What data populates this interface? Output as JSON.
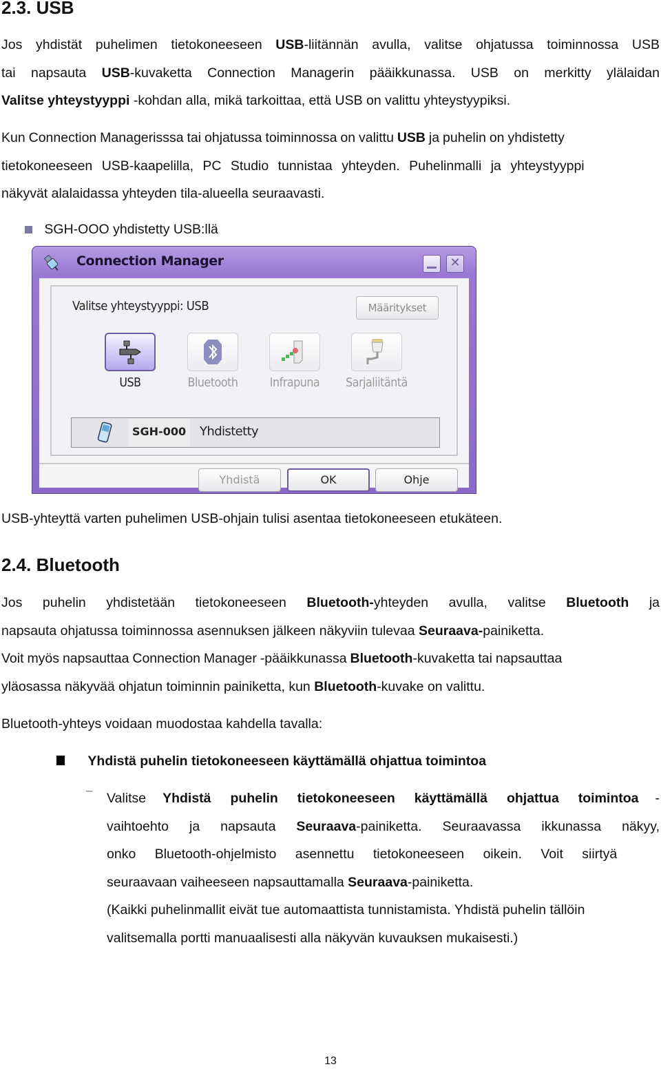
{
  "section_usb": {
    "heading": "2.3. USB",
    "p1": {
      "l1": [
        "Jos yhdistät puhelimen tietokoneeseen ",
        "USB",
        "-liitännän avulla, valitse ohjatussa toiminnossa USB"
      ],
      "l2": [
        "tai napsauta ",
        "USB",
        "-kuvaketta Connection Managerin pääikkunassa. USB on merkitty ylälaidan"
      ],
      "l3": [
        "Valitse yhteystyyppi",
        " -kohdan alla, mikä tarkoittaa, että USB on valittu yhteystyypiksi."
      ]
    },
    "p2": {
      "l1": [
        "Kun Connection Managerisssa tai ohjatussa toiminnossa on valittu ",
        "USB",
        " ja puhelin on yhdistetty"
      ],
      "l2": "tietokoneeseen USB-kaapelilla, PC Studio tunnistaa yhteyden. Puhelinmalli ja yhteystyyppi",
      "l3": "näkyvät alalaidassa yhteyden tila-alueella seuraavasti."
    },
    "bullet": "SGH-OOO yhdistetty USB:llä",
    "after_window": "USB-yhteyttä varten puhelimen USB-ohjain tulisi asentaa tietokoneeseen etukäteen."
  },
  "window": {
    "title": "Connection Manager",
    "app_icon": "usb-plug-icon",
    "minimize_icon": "minimize-icon",
    "close_icon": "close-icon",
    "connection_type_label": "Valitse yhteystyyppi: USB",
    "settings_button": "Määritykset",
    "connection_types": [
      {
        "label": "USB",
        "icon": "usb-icon",
        "selected": true
      },
      {
        "label": "Bluetooth",
        "icon": "bluetooth-icon",
        "selected": false
      },
      {
        "label": "Infrapuna",
        "icon": "infrared-icon",
        "selected": false
      },
      {
        "label": "Sarjaliitäntä",
        "icon": "serial-cable-icon",
        "selected": false
      }
    ],
    "status": {
      "phone_icon": "phone-icon",
      "model": "SGH-000",
      "state": "Yhdistetty"
    },
    "buttons": {
      "connect": "Yhdistä",
      "ok": "OK",
      "help": "Ohje"
    },
    "accent_color": "#9878d2"
  },
  "section_bt": {
    "heading": "2.4. Bluetooth",
    "p1": {
      "l1": [
        "Jos puhelin yhdistetään tietokoneeseen ",
        "Bluetooth-",
        "yhteyden avulla, valitse ",
        "Bluetooth",
        " ja"
      ],
      "l2": [
        "napsauta ohjatussa toiminnossa asennuksen jälkeen näkyviin tulevaa ",
        "Seuraava-",
        "painiketta."
      ],
      "l3": [
        "Voit myös napsauttaa Connection Manager -pääikkunassa ",
        "Bluetooth",
        "-kuvaketta tai napsauttaa"
      ],
      "l4": [
        "yläosassa näkyvää ohjatun toiminnin painiketta, kun ",
        "Bluetooth",
        "-kuvake on valittu."
      ]
    },
    "intro": "Bluetooth-yhteys voidaan muodostaa kahdella tavalla:",
    "bullet_heading": "Yhdistä puhelin tietokoneeseen käyttämällä ohjattua toimintoa",
    "dash": "−",
    "sub": {
      "l1": [
        "Valitse ",
        "Yhdistä puhelin tietokoneeseen käyttämällä ohjattua toimintoa",
        " -"
      ],
      "l2": [
        "vaihtoehto ja napsauta ",
        "Seuraava",
        "-painiketta. Seuraavassa ikkunassa näkyy,"
      ],
      "l3": "onko Bluetooth-ohjelmisto asennettu tietokoneeseen oikein. Voit siirtyä",
      "l4": [
        "seuraavaan vaiheeseen napsauttamalla ",
        "Seuraava",
        "-painiketta."
      ],
      "l5": "(Kaikki puhelinmallit eivät tue automaattista tunnistamista. Yhdistä puhelin tällöin",
      "l6": "valitsemalla portti manuaalisesti alla näkyvän kuvauksen mukaisesti.)"
    }
  },
  "page_number": "13"
}
